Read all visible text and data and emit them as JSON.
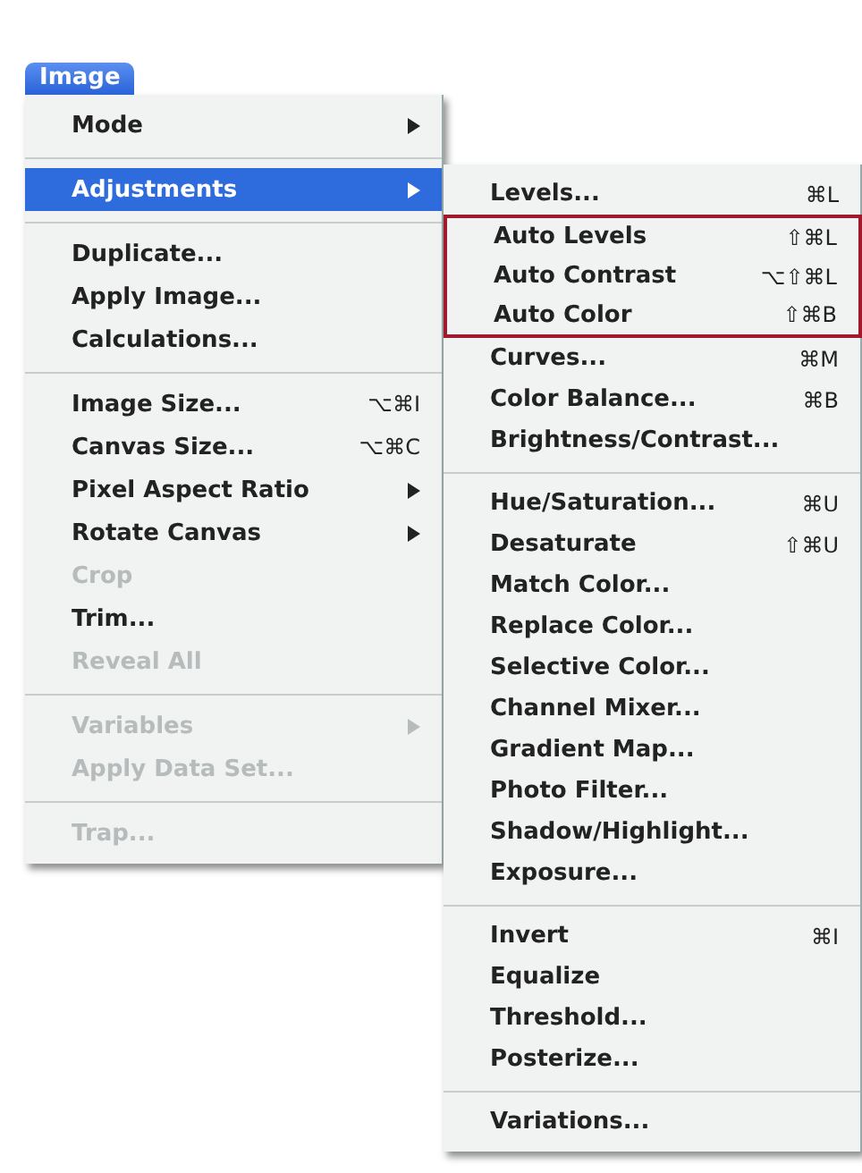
{
  "menu_title": "Image",
  "menu": {
    "items": [
      {
        "kind": "item",
        "label": "Mode",
        "submenu": true,
        "selected": false,
        "disabled": false
      },
      {
        "kind": "separator"
      },
      {
        "kind": "item",
        "label": "Adjustments",
        "submenu": true,
        "selected": true,
        "disabled": false
      },
      {
        "kind": "separator"
      },
      {
        "kind": "item",
        "label": "Duplicate...",
        "submenu": false,
        "selected": false,
        "disabled": false
      },
      {
        "kind": "item",
        "label": "Apply Image...",
        "submenu": false,
        "selected": false,
        "disabled": false
      },
      {
        "kind": "item",
        "label": "Calculations...",
        "submenu": false,
        "selected": false,
        "disabled": false
      },
      {
        "kind": "separator"
      },
      {
        "kind": "item",
        "label": "Image Size...",
        "shortcut": "⌥⌘I",
        "submenu": false,
        "selected": false,
        "disabled": false
      },
      {
        "kind": "item",
        "label": "Canvas Size...",
        "shortcut": "⌥⌘C",
        "submenu": false,
        "selected": false,
        "disabled": false
      },
      {
        "kind": "item",
        "label": "Pixel Aspect Ratio",
        "submenu": true,
        "selected": false,
        "disabled": false
      },
      {
        "kind": "item",
        "label": "Rotate Canvas",
        "submenu": true,
        "selected": false,
        "disabled": false
      },
      {
        "kind": "item",
        "label": "Crop",
        "submenu": false,
        "selected": false,
        "disabled": true
      },
      {
        "kind": "item",
        "label": "Trim...",
        "submenu": false,
        "selected": false,
        "disabled": false
      },
      {
        "kind": "item",
        "label": "Reveal All",
        "submenu": false,
        "selected": false,
        "disabled": true
      },
      {
        "kind": "separator"
      },
      {
        "kind": "item",
        "label": "Variables",
        "submenu": true,
        "selected": false,
        "disabled": true
      },
      {
        "kind": "item",
        "label": "Apply Data Set...",
        "submenu": false,
        "selected": false,
        "disabled": true
      },
      {
        "kind": "separator"
      },
      {
        "kind": "item",
        "label": "Trap...",
        "submenu": false,
        "selected": false,
        "disabled": true
      }
    ]
  },
  "submenu": {
    "items": [
      {
        "kind": "item",
        "label": "Levels...",
        "shortcut": "⌘L",
        "outlined": false
      },
      {
        "kind": "item",
        "label": "Auto Levels",
        "shortcut": "⇧⌘L",
        "outlined": true
      },
      {
        "kind": "item",
        "label": "Auto Contrast",
        "shortcut": "⌥⇧⌘L",
        "outlined": true
      },
      {
        "kind": "item",
        "label": "Auto Color",
        "shortcut": "⇧⌘B",
        "outlined": true
      },
      {
        "kind": "item",
        "label": "Curves...",
        "shortcut": "⌘M",
        "outlined": false
      },
      {
        "kind": "item",
        "label": "Color Balance...",
        "shortcut": "⌘B",
        "outlined": false
      },
      {
        "kind": "item",
        "label": "Brightness/Contrast...",
        "outlined": false
      },
      {
        "kind": "separator"
      },
      {
        "kind": "item",
        "label": "Hue/Saturation...",
        "shortcut": "⌘U",
        "outlined": false
      },
      {
        "kind": "item",
        "label": "Desaturate",
        "shortcut": "⇧⌘U",
        "outlined": false
      },
      {
        "kind": "item",
        "label": "Match Color...",
        "outlined": false
      },
      {
        "kind": "item",
        "label": "Replace Color...",
        "outlined": false
      },
      {
        "kind": "item",
        "label": "Selective Color...",
        "outlined": false
      },
      {
        "kind": "item",
        "label": "Channel Mixer...",
        "outlined": false
      },
      {
        "kind": "item",
        "label": "Gradient Map...",
        "outlined": false
      },
      {
        "kind": "item",
        "label": "Photo Filter...",
        "outlined": false
      },
      {
        "kind": "item",
        "label": "Shadow/Highlight...",
        "outlined": false
      },
      {
        "kind": "item",
        "label": "Exposure...",
        "outlined": false
      },
      {
        "kind": "separator"
      },
      {
        "kind": "item",
        "label": "Invert",
        "shortcut": "⌘I",
        "outlined": false
      },
      {
        "kind": "item",
        "label": "Equalize",
        "outlined": false
      },
      {
        "kind": "item",
        "label": "Threshold...",
        "outlined": false
      },
      {
        "kind": "item",
        "label": "Posterize...",
        "outlined": false
      },
      {
        "kind": "separator"
      },
      {
        "kind": "item",
        "label": "Variations...",
        "outlined": false
      }
    ]
  }
}
